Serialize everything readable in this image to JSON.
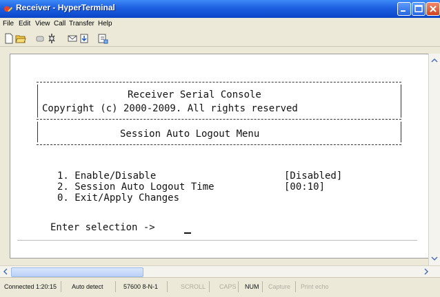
{
  "window": {
    "title": "Receiver - HyperTerminal"
  },
  "menu": [
    "File",
    "Edit",
    "View",
    "Call",
    "Transfer",
    "Help"
  ],
  "toolbar": [
    "new-icon",
    "open-icon",
    "disconnect-icon",
    "properties-icon",
    "send-icon",
    "receive-icon",
    "settings-icon"
  ],
  "console": {
    "header_title": "Receiver Serial Console",
    "copyright": "Copyright (c) 2000-2009. All rights reserved",
    "menu_title": "Session Auto Logout Menu",
    "options": [
      {
        "label": "1. Enable/Disable",
        "value": "[Disabled]"
      },
      {
        "label": "2. Session Auto Logout Time",
        "value": "[00:10]"
      },
      {
        "label": "0. Exit/Apply Changes",
        "value": ""
      }
    ],
    "prompt": "Enter selection -> "
  },
  "status": {
    "connected": "Connected 1:20:15",
    "detect": "Auto detect",
    "settings": "57600 8-N-1",
    "scroll": "SCROLL",
    "caps": "CAPS",
    "num": "NUM",
    "capture": "Capture",
    "print_echo": "Print echo"
  }
}
